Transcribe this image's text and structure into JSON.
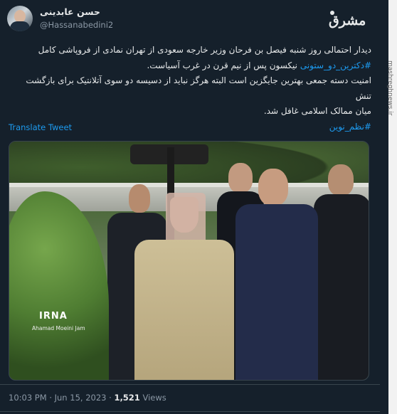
{
  "author": {
    "display_name": "حسن عابدینی",
    "handle": "@Hassanabedini2"
  },
  "logo_text": "مشرق",
  "watermark": "mashreghnews.ir",
  "tweet": {
    "line1": "دیدار احتمالی روز شنبه فیصل بن فرحان وزیر خارجه سعودی از تهران نمادی از فروپاشی کامل",
    "hashtag1": "#دکترین_دو_ستونی",
    "line2_rest": " نیکسون پس از نیم قرن در غرب آسیاست.",
    "line3": "امنیت دسته جمعی بهترین جایگزین است البته هرگز نباید از دسیسه دو سوی آتلانتیک برای بازگشت تنش",
    "line4": "میان ممالک اسلامی غافل شد.",
    "hashtag2": "#نظم_نوین"
  },
  "translate_label": "Translate Tweet",
  "photo": {
    "agency": "IRNA",
    "credit": "Ahamad Moeini Jam"
  },
  "meta": {
    "time": "10:03 PM",
    "date": "Jun 15, 2023",
    "views": "1,521",
    "views_label": "Views"
  }
}
